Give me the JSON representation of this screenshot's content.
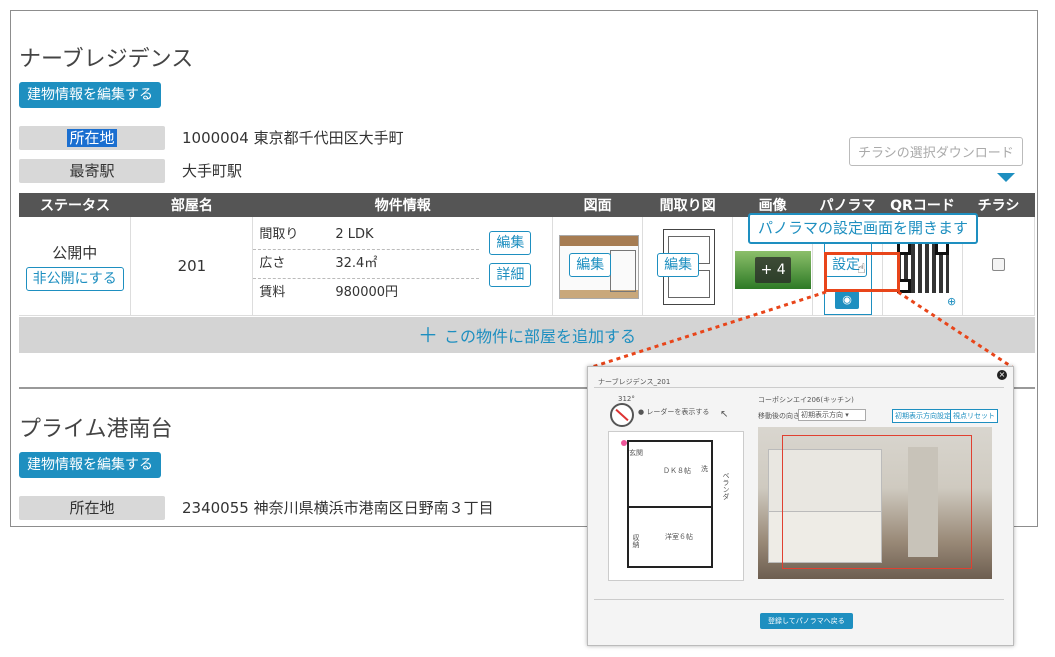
{
  "building1": {
    "name": "ナーブレジデンス",
    "edit_label": "建物情報を編集する",
    "address_label": "所在地",
    "address_value": "1000004 東京都千代田区大手町",
    "station_label": "最寄駅",
    "station_value": "大手町駅"
  },
  "flyer_download_label": "チラシの選択ダウンロード",
  "table": {
    "headers": [
      "ステータス",
      "部屋名",
      "物件情報",
      "図面",
      "間取り図",
      "画像",
      "パノラマ",
      "QRコード",
      "チラシ"
    ],
    "row": {
      "status": "公開中",
      "unpublish_label": "非公開にする",
      "room": "201",
      "info": [
        {
          "k": "間取り",
          "v": "2 LDK"
        },
        {
          "k": "広さ",
          "v": "32.4㎡"
        },
        {
          "k": "賃料",
          "v": "980000円"
        }
      ],
      "edit_label": "編集",
      "detail_label": "詳細",
      "drawing_edit": "編集",
      "floorplan_edit": "編集",
      "image_more": "+ 4",
      "panorama_setting": "設定"
    }
  },
  "add_room_label": "この物件に部屋を追加する",
  "tooltip": "パノラマの設定画面を開きます",
  "building2": {
    "name": "プライム港南台",
    "edit_label": "建物情報を編集する",
    "address_label": "所在地",
    "address_value": "2340055 神奈川県横浜市港南区日野南３丁目"
  },
  "popup": {
    "title": "ナーブレジデンス_201",
    "heading_angle": "312°",
    "radar_label": "レーダーを表示する",
    "panorama_name": "コーポシンエイ206(キッチン)",
    "direction_label": "移動後の向き",
    "direction_value": "初期表示方向",
    "btn_initial": "初期表示方向設定",
    "btn_reset": "視点リセット",
    "submit_label": "登録してパノラマへ戻る",
    "room_dk": "ＤＫ８帖",
    "room_west": "洋室６帖",
    "room_balcony": "ベランダ",
    "room_storage": "収納",
    "room_entrance": "玄関",
    "room_wash": "洗"
  },
  "colors": {
    "accent": "#1e8fc0",
    "highlight": "#e8451a",
    "header": "#555555"
  }
}
